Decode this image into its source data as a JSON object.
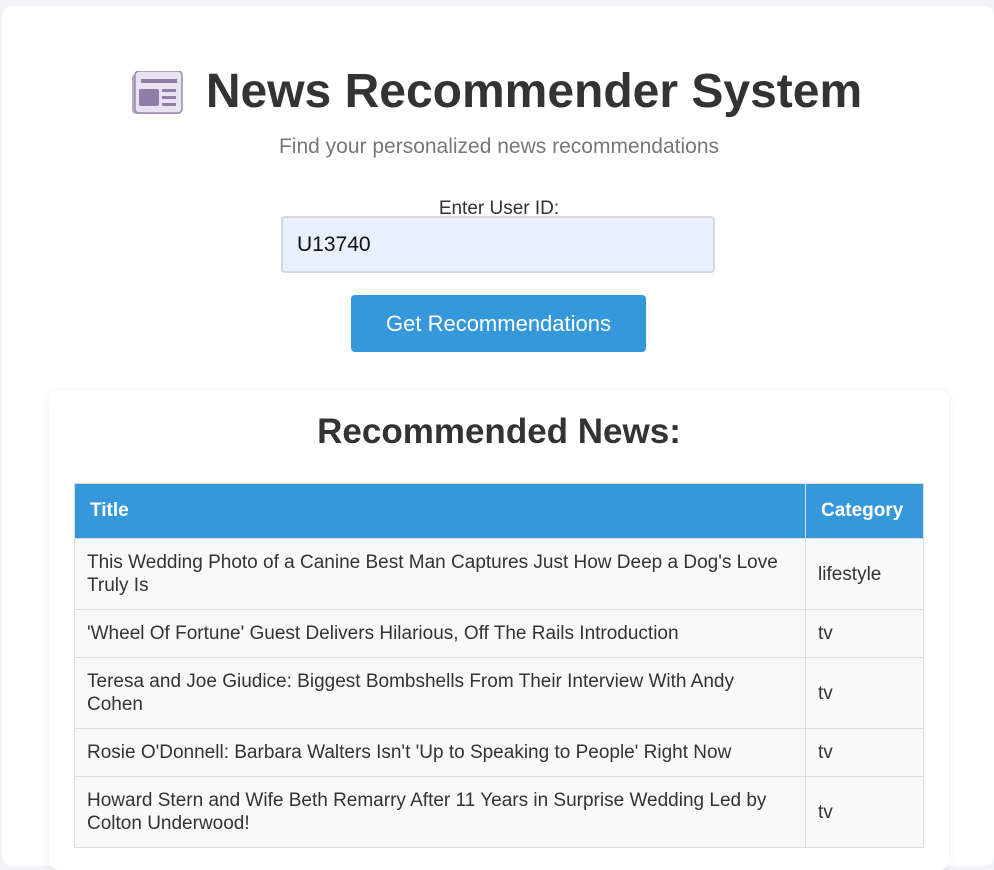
{
  "app": {
    "title": "News Recommender System",
    "subtitle": "Find your personalized news recommendations",
    "icon": "newspaper-icon"
  },
  "form": {
    "label": "Enter User ID:",
    "user_id_value": "U13740",
    "button_label": "Get Recommendations"
  },
  "results": {
    "heading": "Recommended News:",
    "columns": [
      "Title",
      "Category"
    ],
    "rows": [
      {
        "title": "This Wedding Photo of a Canine Best Man Captures Just How Deep a Dog's Love Truly Is",
        "category": "lifestyle"
      },
      {
        "title": "'Wheel Of Fortune' Guest Delivers Hilarious, Off The Rails Introduction",
        "category": "tv"
      },
      {
        "title": "Teresa and Joe Giudice: Biggest Bombshells From Their Interview With Andy Cohen",
        "category": "tv"
      },
      {
        "title": "Rosie O'Donnell: Barbara Walters Isn't 'Up to Speaking to People' Right Now",
        "category": "tv"
      },
      {
        "title": "Howard Stern and Wife Beth Remarry After 11 Years in Surprise Wedding Led by Colton Underwood!",
        "category": "tv"
      }
    ]
  },
  "colors": {
    "accent": "#3498db",
    "input_bg": "#e8f0fe",
    "heading_text": "#333333",
    "muted_text": "#777777"
  }
}
